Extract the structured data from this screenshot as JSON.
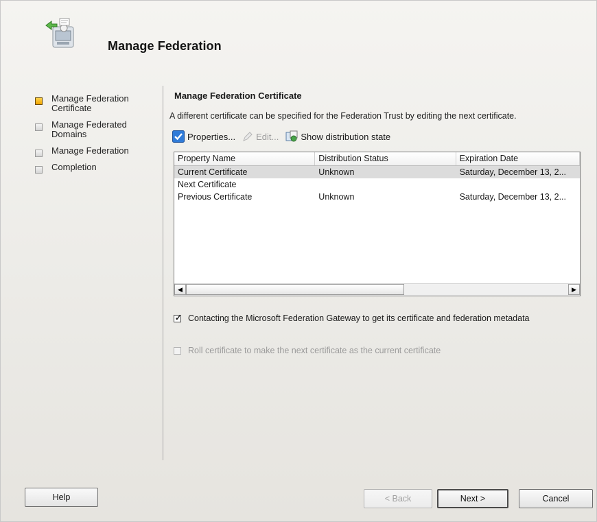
{
  "header": {
    "title": "Manage Federation",
    "icon": "federation-wizard-icon"
  },
  "left_nav": {
    "items": [
      {
        "label": "Manage Federation Certificate",
        "active": true
      },
      {
        "label": "Manage Federated Domains",
        "active": false
      },
      {
        "label": "Manage Federation",
        "active": false
      },
      {
        "label": "Completion",
        "active": false
      }
    ]
  },
  "main": {
    "section_title": "Manage Federation Certificate",
    "description": "A different certificate can be specified for the Federation Trust by editing the next certificate.",
    "toolbar": {
      "properties_label": "Properties...",
      "edit_label": "Edit...",
      "show_distribution_label": "Show distribution state"
    },
    "table": {
      "columns": [
        "Property Name",
        "Distribution Status",
        "Expiration Date"
      ],
      "rows": [
        {
          "name": "Current Certificate",
          "status": "Unknown",
          "expiration": "Saturday, December 13, 2..."
        },
        {
          "name": "Next Certificate",
          "status": "",
          "expiration": ""
        },
        {
          "name": "Previous Certificate",
          "status": "Unknown",
          "expiration": "Saturday, December 13, 2..."
        }
      ],
      "selected_row": 0
    },
    "checkboxes": {
      "contact_gateway": {
        "label": "Contacting the Microsoft Federation Gateway to get its certificate and federation metadata",
        "checked": true,
        "enabled": true
      },
      "roll_certificate": {
        "label": "Roll certificate to make the next certificate as the current certificate",
        "checked": false,
        "enabled": false
      }
    }
  },
  "buttons": {
    "help": "Help",
    "back": "< Back",
    "next": "Next >",
    "cancel": "Cancel"
  },
  "colors": {
    "active_step": "#f0a400",
    "selected_row": "#dcdcdc",
    "window_bg": "#ecebe7"
  }
}
